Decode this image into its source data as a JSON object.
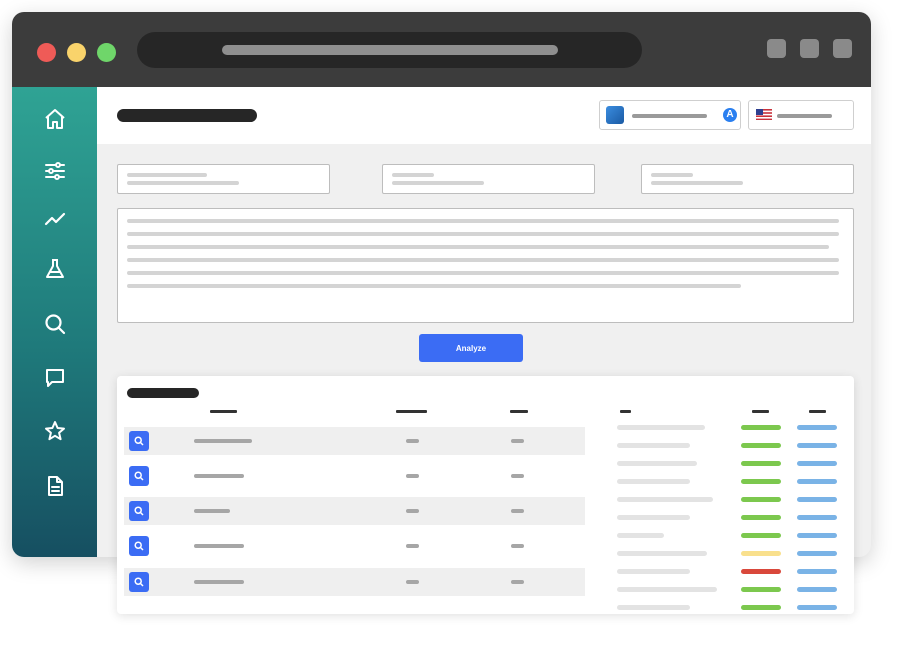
{
  "window": {
    "traffic_lights": {
      "close": "#ef5b57",
      "minimize": "#f9d36b",
      "maximize": "#6fd66a"
    },
    "url_bar": "placeholder",
    "controls": [
      "window-control-1",
      "window-control-2",
      "window-control-3"
    ]
  },
  "sidebar": {
    "gradient": [
      "#2fa394",
      "#164f61"
    ],
    "items": [
      {
        "icon": "home-icon"
      },
      {
        "icon": "sliders-icon"
      },
      {
        "icon": "trend-icon"
      },
      {
        "icon": "flask-icon"
      },
      {
        "icon": "search-icon"
      },
      {
        "icon": "message-icon"
      },
      {
        "icon": "star-icon"
      },
      {
        "icon": "document-icon"
      }
    ]
  },
  "header": {
    "app_select": {
      "icon": "app-icon",
      "store_icon": "app-store-icon"
    },
    "language_select": {
      "flag": "us-flag-icon"
    }
  },
  "form": {
    "fields": 3,
    "analyze_label": "Analyze"
  },
  "results": {
    "rows": [
      {
        "shaded": true
      },
      {
        "shaded": false
      },
      {
        "shaded": true
      },
      {
        "shaded": false
      },
      {
        "shaded": true
      }
    ],
    "side_list": [
      {
        "status": "green"
      },
      {
        "status": "green"
      },
      {
        "status": "green"
      },
      {
        "status": "green"
      },
      {
        "status": "green"
      },
      {
        "status": "green"
      },
      {
        "status": "green"
      },
      {
        "status": "yellow"
      },
      {
        "status": "red"
      },
      {
        "status": "green"
      },
      {
        "status": "green"
      }
    ]
  },
  "colors": {
    "accent": "#3b6cf4",
    "status_green": "#7cc84e",
    "status_yellow": "#f9e08d",
    "status_red": "#d9483b",
    "status_blue": "#7ab3e6"
  }
}
